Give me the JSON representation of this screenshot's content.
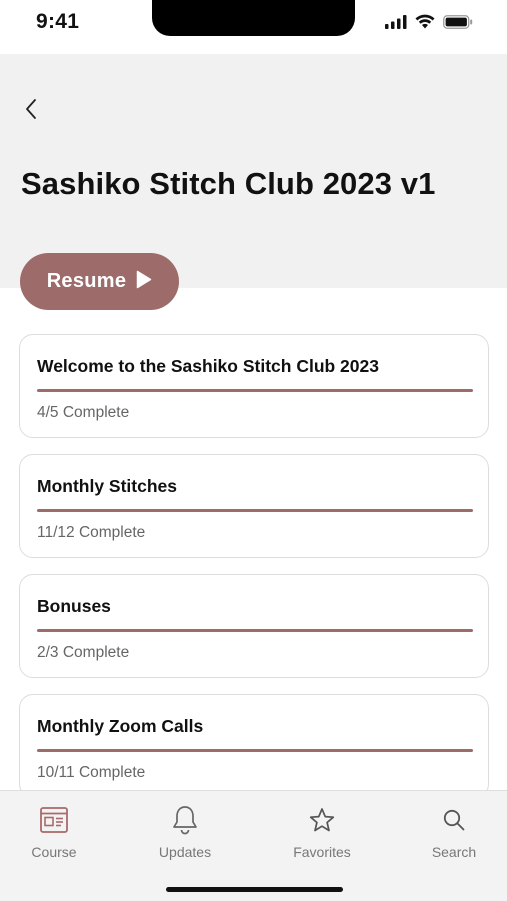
{
  "status_bar": {
    "time": "9:41",
    "icons": [
      "signal-icon",
      "wifi-icon",
      "battery-icon"
    ]
  },
  "header": {
    "back_icon": "chevron-left-icon",
    "title": "Sashiko Stitch Club 2023 v1"
  },
  "resume": {
    "label": "Resume",
    "icon": "play-icon"
  },
  "modules": [
    {
      "title": "Welcome to the Sashiko Stitch Club 2023",
      "status": "4/5 Complete",
      "progress": 1.0
    },
    {
      "title": "Monthly Stitches",
      "status": "11/12 Complete",
      "progress": 1.0
    },
    {
      "title": "Bonuses",
      "status": "2/3 Complete",
      "progress": 1.0
    },
    {
      "title": "Monthly Zoom Calls",
      "status": "10/11 Complete",
      "progress": 1.0
    }
  ],
  "tab_bar": {
    "items": [
      {
        "label": "Course",
        "icon": "course-icon"
      },
      {
        "label": "Updates",
        "icon": "bell-icon"
      },
      {
        "label": "Favorites",
        "icon": "star-icon"
      },
      {
        "label": "Search",
        "icon": "search-icon"
      }
    ]
  },
  "colors": {
    "accent": "#9c6b6a",
    "header_bg": "#f1f1f1",
    "tab_bar_bg": "#f3f3f3",
    "course_icon": "#a86a6a"
  }
}
